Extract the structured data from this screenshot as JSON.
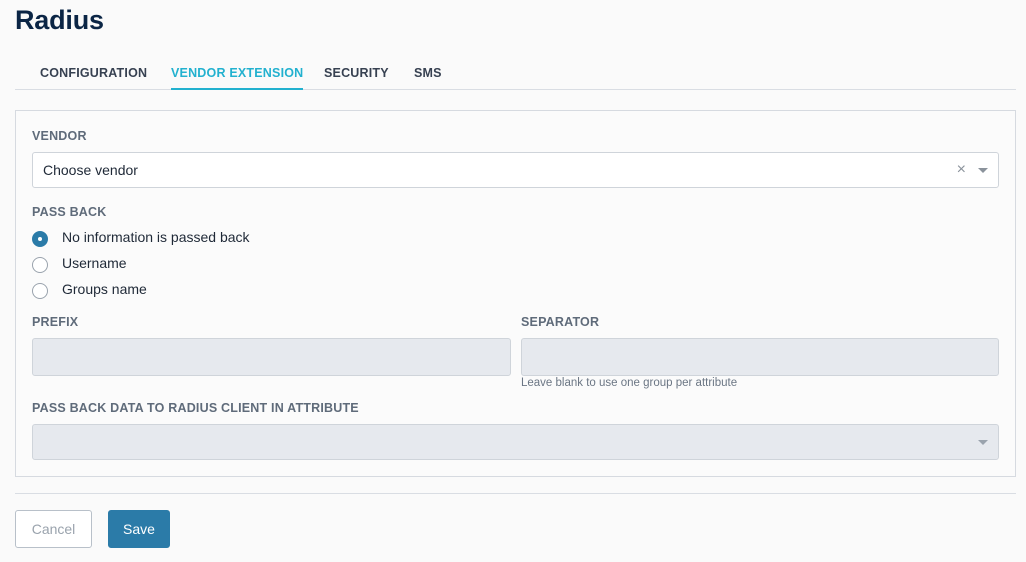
{
  "page": {
    "title": "Radius"
  },
  "tabs": [
    {
      "label": "CONFIGURATION",
      "active": false
    },
    {
      "label": "VENDOR EXTENSION",
      "active": true
    },
    {
      "label": "SECURITY",
      "active": false
    },
    {
      "label": "SMS",
      "active": false
    }
  ],
  "form": {
    "vendor": {
      "label": "VENDOR",
      "value": "Choose vendor",
      "clear_glyph": "×"
    },
    "pass_back": {
      "label": "PASS BACK",
      "options": [
        {
          "label": "No information is passed back",
          "checked": true
        },
        {
          "label": "Username",
          "checked": false
        },
        {
          "label": "Groups name",
          "checked": false
        }
      ]
    },
    "prefix": {
      "label": "PREFIX",
      "value": ""
    },
    "separator": {
      "label": "SEPARATOR",
      "value": "",
      "help": "Leave blank to use one group per attribute"
    },
    "attribute": {
      "label": "PASS BACK DATA TO RADIUS CLIENT IN ATTRIBUTE",
      "value": ""
    }
  },
  "actions": {
    "cancel_label": "Cancel",
    "save_label": "Save"
  },
  "colors": {
    "accent": "#22b1cf",
    "primary": "#2b7ba8",
    "title": "#0b2545"
  }
}
